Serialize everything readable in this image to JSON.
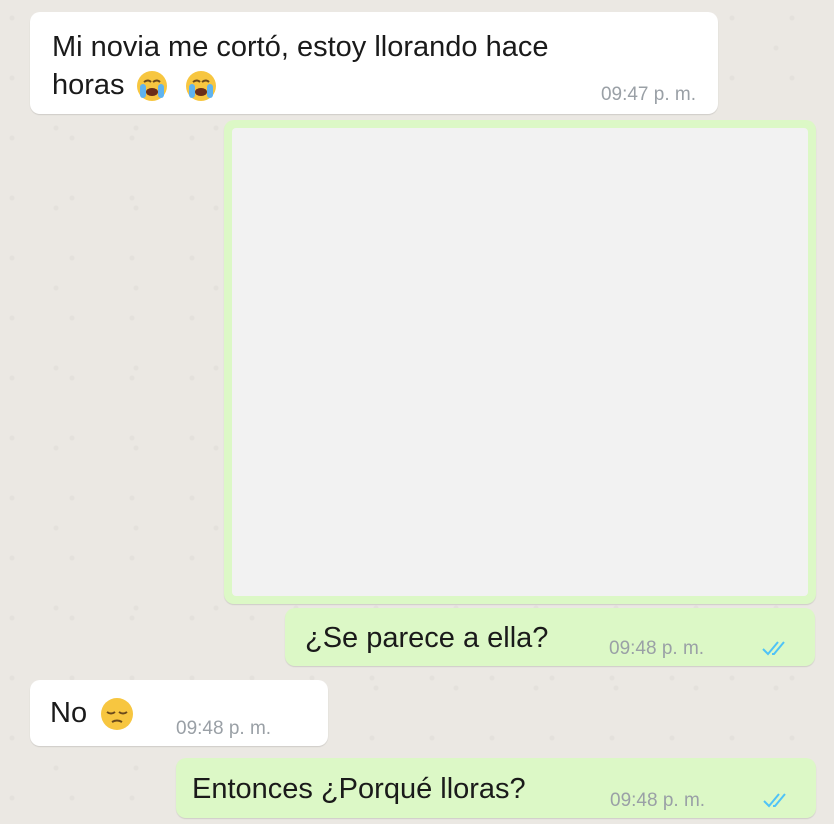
{
  "messages": [
    {
      "text_line1": "Mi novia me cortó, estoy llorando hace",
      "text_line2": "horas",
      "time": "09:47 p. m.",
      "emoji": "loudly-crying-face"
    },
    {
      "type": "image"
    },
    {
      "text": "¿Se parece a ella?",
      "time": "09:48 p. m.",
      "status": "read"
    },
    {
      "text": "No",
      "time": "09:48 p. m.",
      "emoji": "pensive-face"
    },
    {
      "text": "Entonces ¿Porqué lloras?",
      "time": "09:48 p. m.",
      "status": "read"
    }
  ],
  "colors": {
    "incoming_bubble": "#ffffff",
    "outgoing_bubble": "#dcf8c6",
    "read_ticks": "#4fc3f7",
    "background": "#ebe8e3"
  }
}
